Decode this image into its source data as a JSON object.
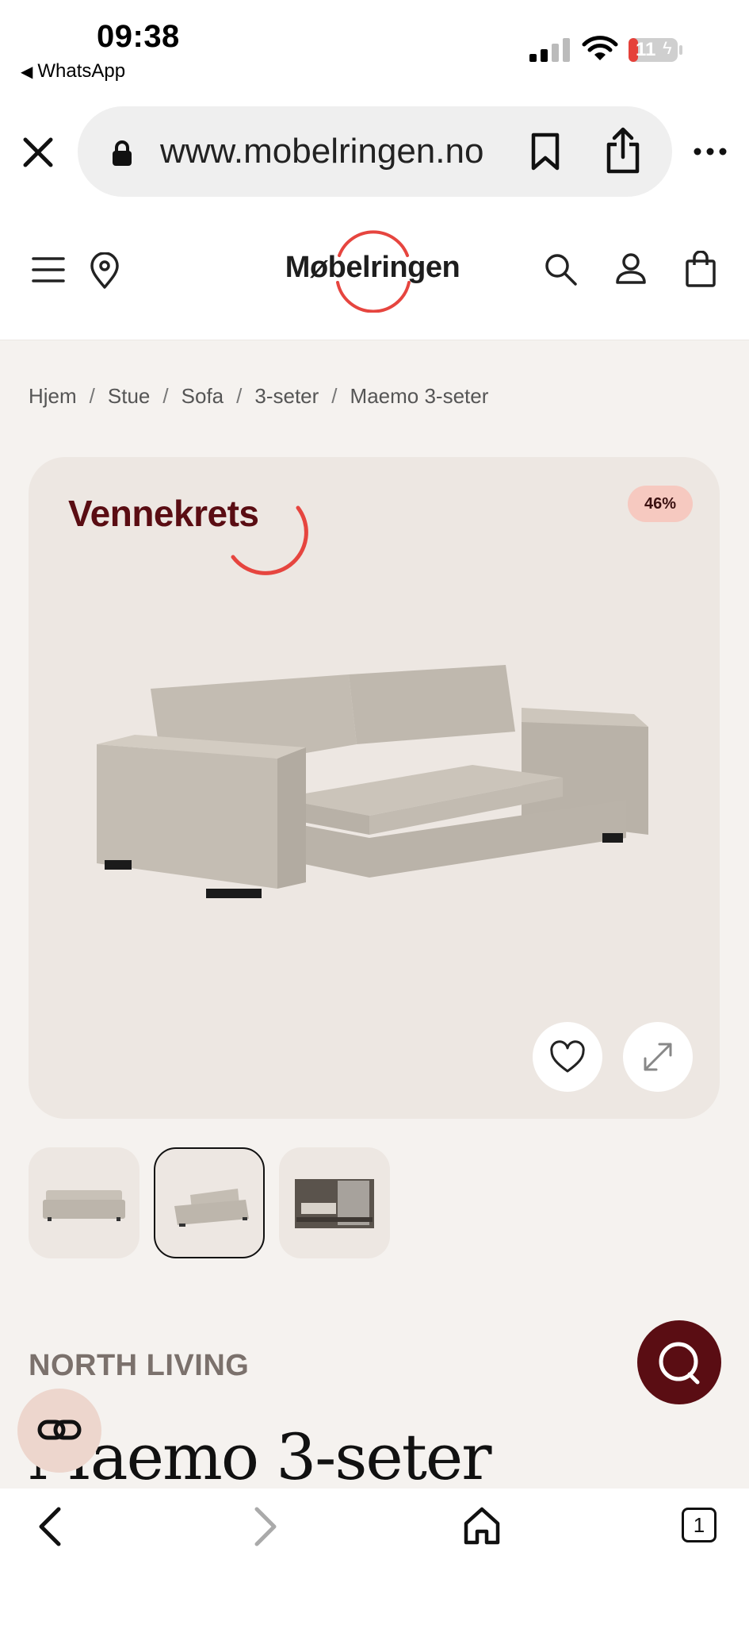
{
  "status_bar": {
    "time": "09:38",
    "back_app": "WhatsApp",
    "battery": "11"
  },
  "browser": {
    "url": "www.mobelringen.no",
    "tab_count": "1"
  },
  "header": {
    "logo": "Møbelringen",
    "brand_color": "#e6453f"
  },
  "breadcrumb": [
    "Hjem",
    "Stue",
    "Sofa",
    "3-seter",
    "Maemo 3-seter"
  ],
  "product": {
    "campaign_label": "Vennekrets",
    "campaign_color": "#5a0d13",
    "discount": "46%",
    "brand": "NORTH LIVING",
    "title": "Maemo 3-seter",
    "thumbnails": [
      "sofa-front",
      "sofa-angle",
      "sofa-in-room"
    ],
    "selected_thumbnail": 1
  },
  "icons": {
    "top": [
      "close-icon",
      "lock-icon",
      "bookmark-icon",
      "share-icon",
      "more-icon"
    ],
    "header": [
      "menu-icon",
      "location-pin-icon",
      "search-icon",
      "user-icon",
      "shopping-bag-icon"
    ],
    "card": [
      "heart-icon",
      "expand-icon"
    ],
    "bottom": [
      "back-icon",
      "forward-icon",
      "home-icon",
      "tabs-icon"
    ]
  }
}
